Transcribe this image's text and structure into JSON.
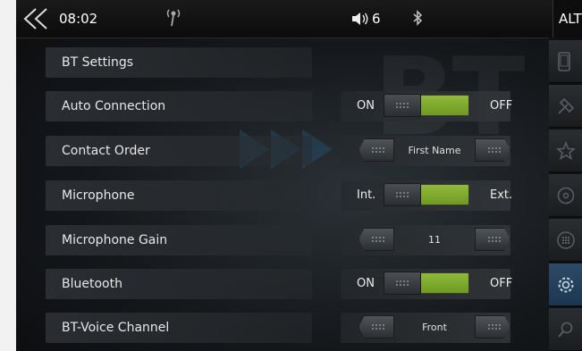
{
  "statusbar": {
    "time": "08:02",
    "volume": "6",
    "alt_label": "ALT",
    "icons": [
      "back-chevron-icon",
      "signal-antenna-icon",
      "volume-icon",
      "bluetooth-icon"
    ]
  },
  "watermark": "BT",
  "settings": {
    "header": "BT Settings",
    "auto_connection": {
      "label": "Auto Connection",
      "left": "ON",
      "right": "OFF"
    },
    "contact_order": {
      "label": "Contact Order",
      "value": "First Name"
    },
    "microphone": {
      "label": "Microphone",
      "left": "Int.",
      "right": "Ext."
    },
    "microphone_gain": {
      "label": "Microphone Gain",
      "value": "11"
    },
    "bluetooth": {
      "label": "Bluetooth",
      "left": "ON",
      "right": "OFF"
    },
    "bt_voice_channel": {
      "label": "BT-Voice Channel",
      "value": "Front"
    }
  },
  "rightnav": {
    "items": [
      "phone-icon",
      "tools-icon",
      "star-icon",
      "steering-icon",
      "grid-icon",
      "settings-gear-icon",
      "search-icon"
    ],
    "active": "settings-gear-icon"
  },
  "colors": {
    "toggle_on": "#8fba3a",
    "active_nav": "#2d4a66"
  }
}
